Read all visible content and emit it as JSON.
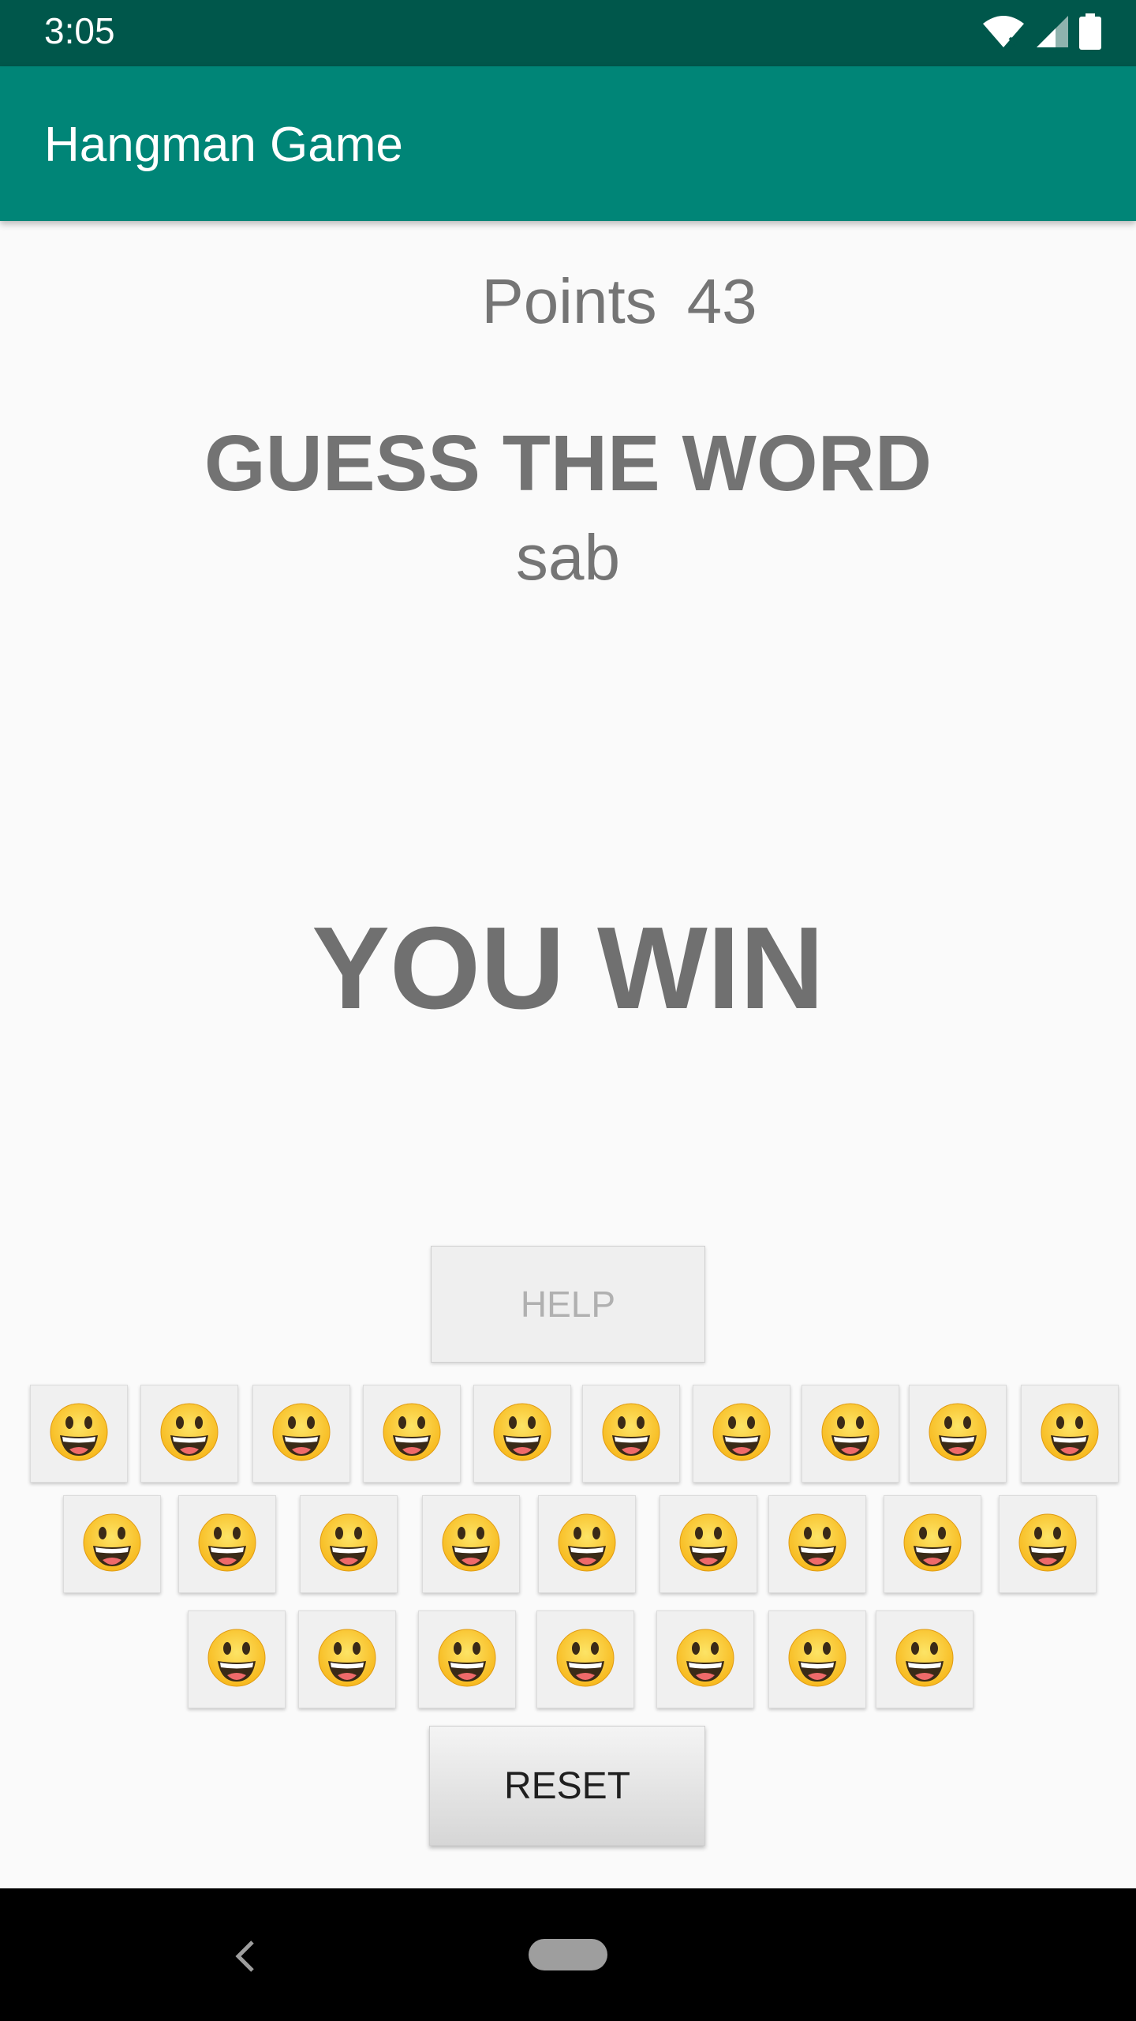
{
  "status_bar": {
    "time": "3:05",
    "icons": [
      "wifi-icon",
      "signal-icon",
      "battery-icon"
    ]
  },
  "app_bar": {
    "title": "Hangman Game",
    "color": "#008577"
  },
  "score": {
    "label": "Points",
    "value": "43"
  },
  "game": {
    "prompt": "GUESS THE WORD",
    "word": "sab",
    "result": "YOU WIN"
  },
  "buttons": {
    "help_label": "HELP",
    "reset_label": "RESET"
  },
  "keyboard": {
    "key_icon": "smiley-face-icon",
    "rows": [
      10,
      9,
      7
    ]
  },
  "nav_bar": {
    "icons": [
      "back-icon",
      "home-pill-icon"
    ]
  }
}
